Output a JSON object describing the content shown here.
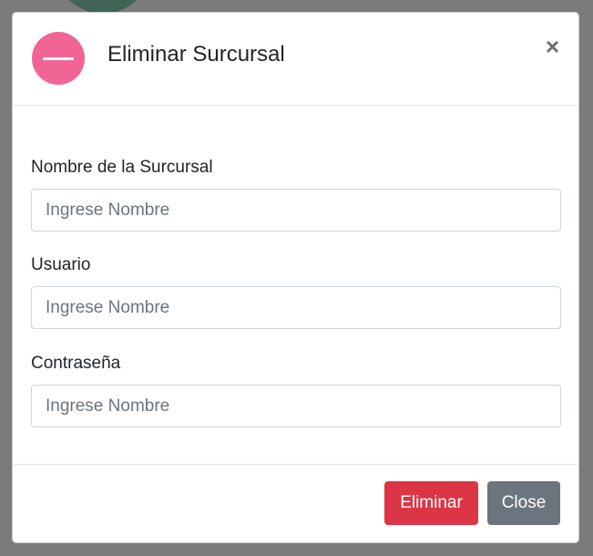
{
  "modal": {
    "title": "Eliminar Surcursal",
    "header_icon": "minus-circle-icon",
    "close_symbol": "×",
    "fields": [
      {
        "label": "Nombre de la Surcursal",
        "placeholder": "Ingrese Nombre",
        "value": ""
      },
      {
        "label": "Usuario",
        "placeholder": "Ingrese Nombre",
        "value": ""
      },
      {
        "label": "Contraseña",
        "placeholder": "Ingrese Nombre",
        "value": ""
      }
    ],
    "buttons": {
      "delete_label": "Eliminar",
      "close_label": "Close"
    }
  },
  "colors": {
    "icon_pink": "#f06595",
    "delete_red": "#dc3545",
    "close_gray": "#6c757d",
    "backdrop": "#7b7b7b"
  }
}
